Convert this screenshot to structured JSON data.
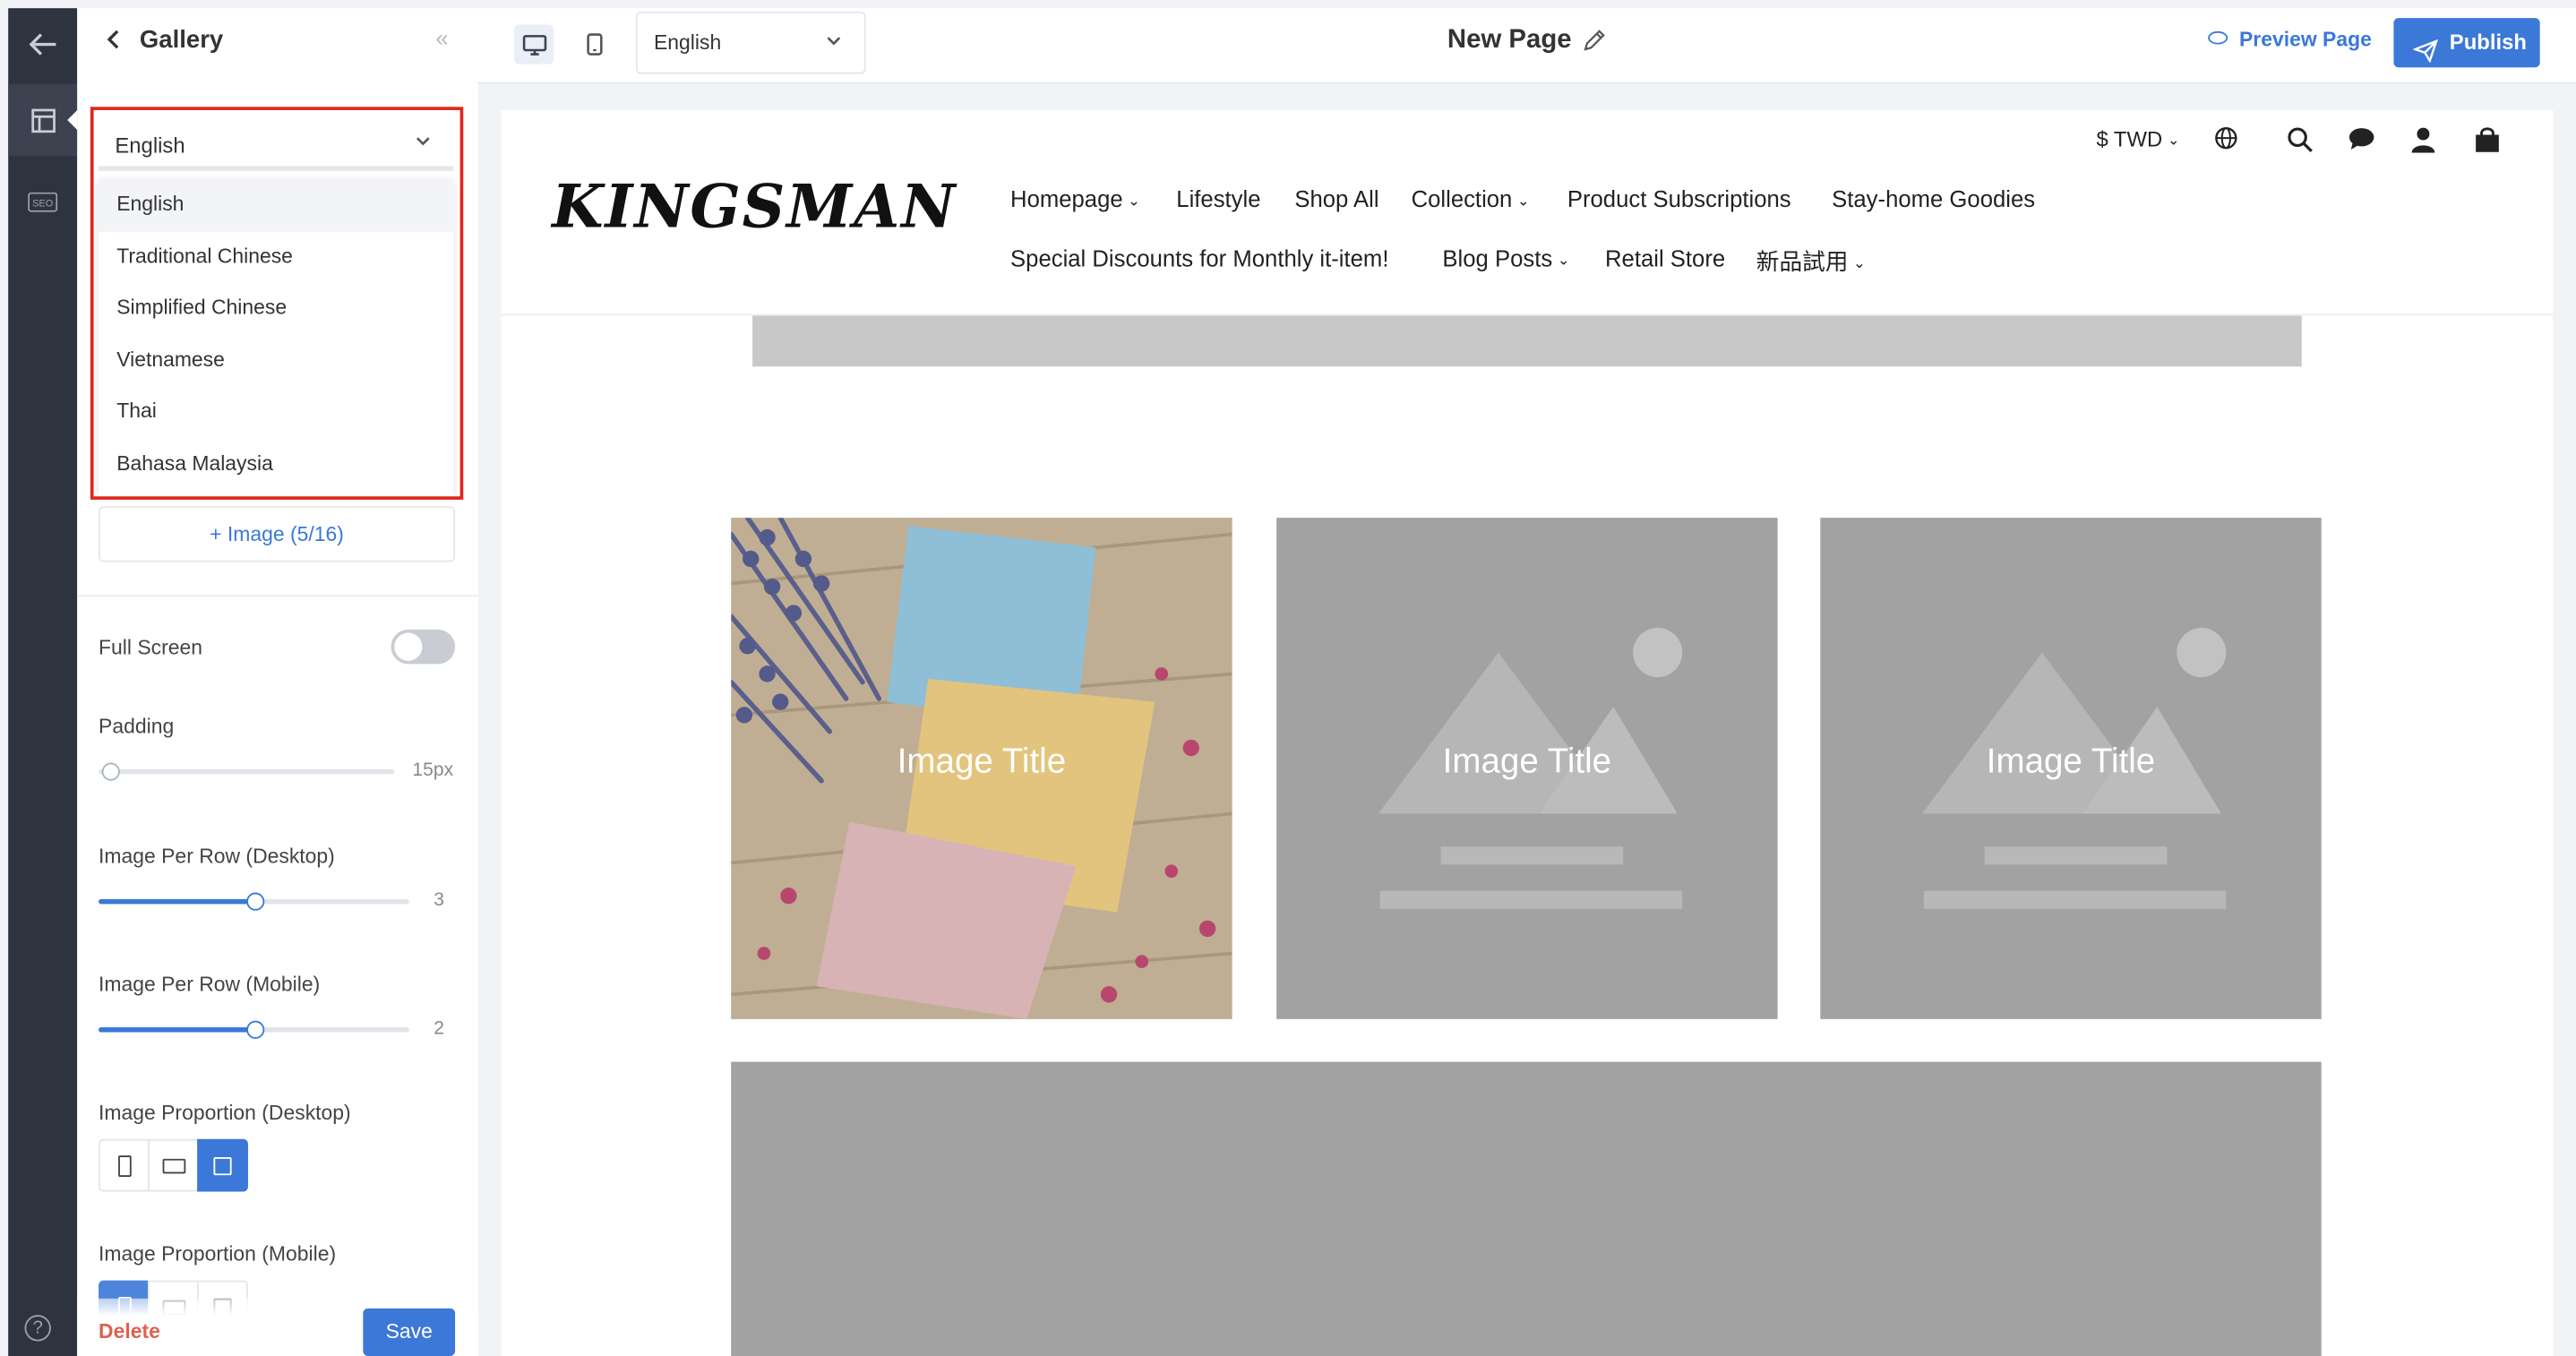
{
  "rail": {
    "items": [
      {
        "name": "back-arrow-icon",
        "glyph": "←"
      },
      {
        "name": "layout-icon",
        "glyph": "▤"
      },
      {
        "name": "seo-icon",
        "glyph": "SEO"
      }
    ],
    "help_glyph": "?"
  },
  "panel": {
    "title": "Gallery",
    "language_select": {
      "value": "English",
      "options": [
        "English",
        "Traditional Chinese",
        "Simplified Chinese",
        "Vietnamese",
        "Thai",
        "Bahasa Malaysia"
      ],
      "selected_index": 0
    },
    "add_image_label": "+ Image (5/16)",
    "full_screen": {
      "label": "Full Screen",
      "on": false
    },
    "padding": {
      "label": "Padding",
      "value_text": "15px",
      "fraction": 0.0
    },
    "per_row_desktop": {
      "label": "Image Per Row (Desktop)",
      "value": "3",
      "fraction": 0.5
    },
    "per_row_mobile": {
      "label": "Image Per Row (Mobile)",
      "value": "2",
      "fraction": 0.5
    },
    "proportion_desktop": {
      "label": "Image Proportion (Desktop)",
      "options": [
        "portrait",
        "landscape",
        "square"
      ],
      "selected": "square"
    },
    "proportion_mobile": {
      "label": "Image Proportion (Mobile)"
    },
    "delete_label": "Delete",
    "save_label": "Save"
  },
  "topbar": {
    "language": "English",
    "page_title": "New Page",
    "preview_label": "Preview Page",
    "publish_label": "Publish"
  },
  "site": {
    "logo": "KINGSMAN",
    "currency": "$ TWD",
    "nav_row1": [
      {
        "label": "Homepage",
        "dropdown": true
      },
      {
        "label": "Lifestyle",
        "dropdown": false
      },
      {
        "label": "Shop All",
        "dropdown": false
      },
      {
        "label": "Collection",
        "dropdown": true
      },
      {
        "label": "Product Subscriptions",
        "dropdown": false
      },
      {
        "label": "Stay-home Goodies",
        "dropdown": false
      }
    ],
    "nav_row2": [
      {
        "label": "Special Discounts for Monthly it-item!",
        "dropdown": false
      },
      {
        "label": "Blog Posts",
        "dropdown": true
      },
      {
        "label": "Retail Store",
        "dropdown": false
      },
      {
        "label": "新品試用",
        "dropdown": true
      }
    ],
    "gallery": [
      {
        "title": "Image Title",
        "kind": "photo"
      },
      {
        "title": "Image Title",
        "kind": "placeholder"
      },
      {
        "title": "Image Title",
        "kind": "placeholder"
      }
    ]
  },
  "colors": {
    "accent": "#3b78d8",
    "highlight": "#e0281b",
    "danger": "#e0604f",
    "placeholder": "#a2a2a2"
  }
}
